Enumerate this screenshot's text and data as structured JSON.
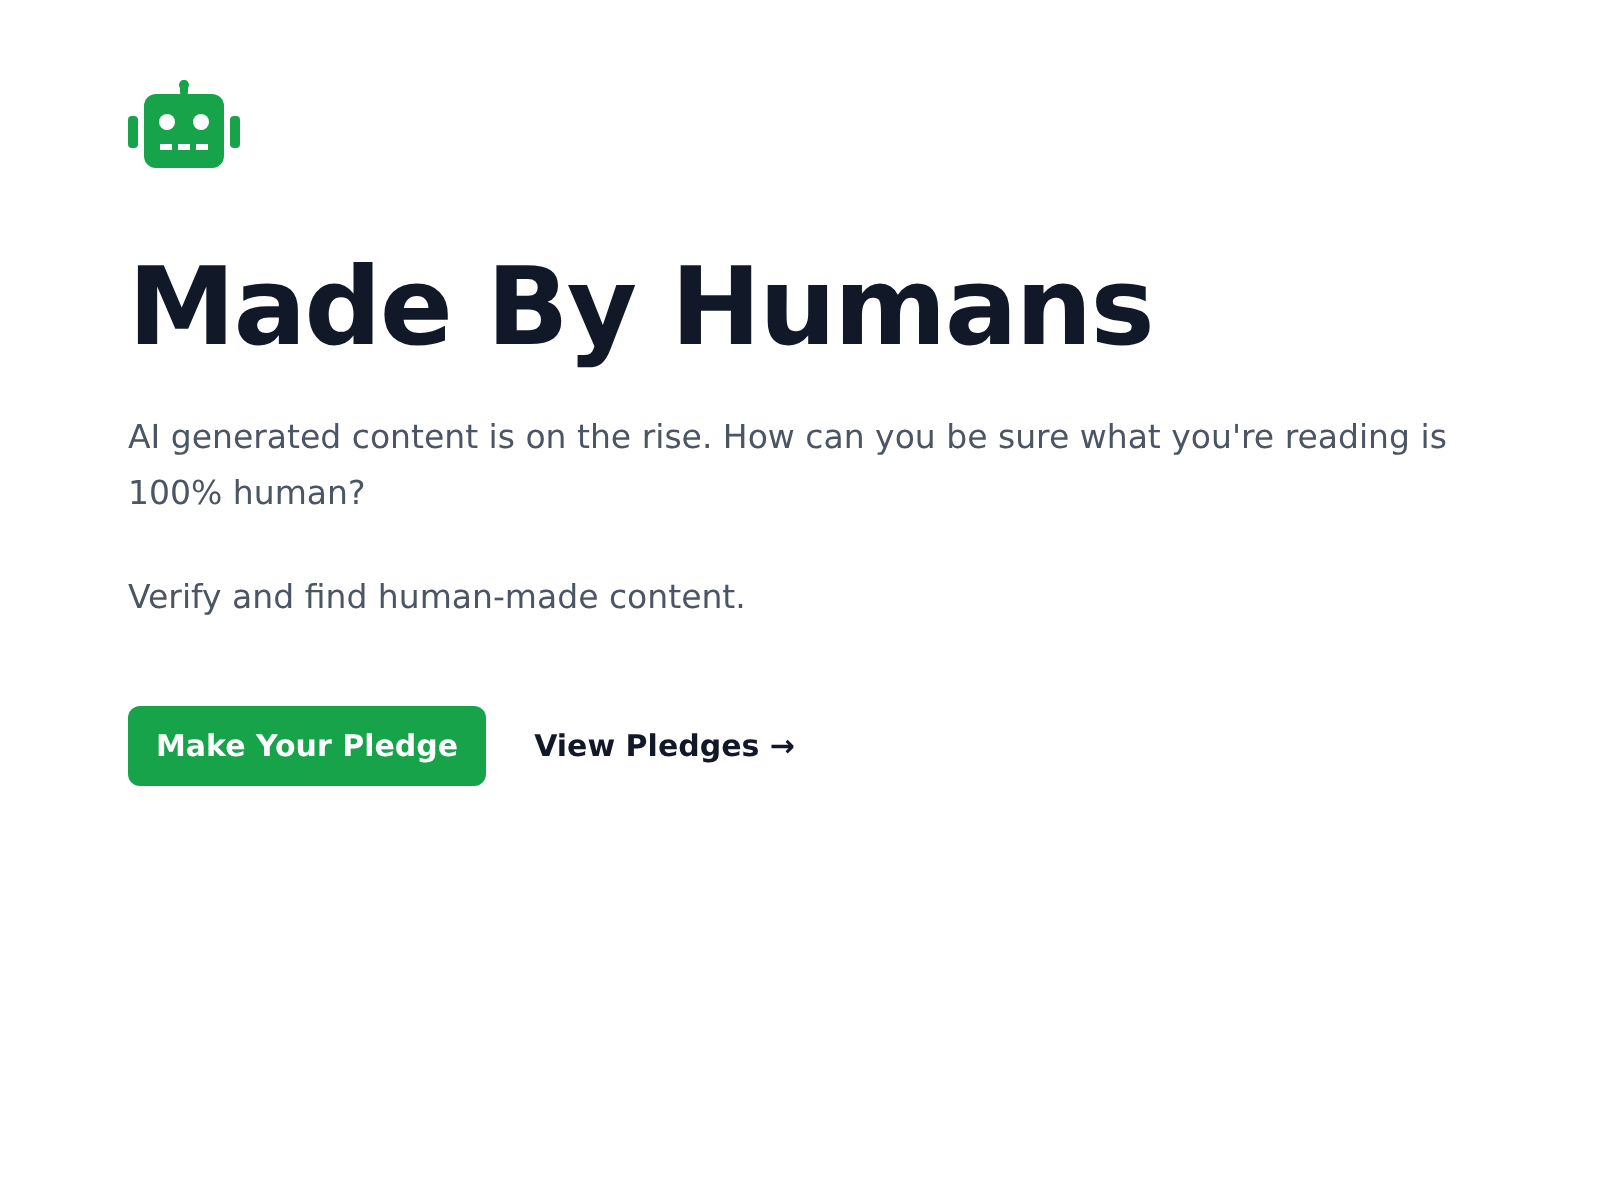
{
  "hero": {
    "title": "Made By Humans",
    "paragraphs": [
      "AI generated content is on the rise. How can you be sure what you're reading is 100% human?",
      "Verify and find human-made content."
    ]
  },
  "actions": [
    {
      "kind": "primary",
      "label": "Make Your Pledge"
    },
    {
      "kind": "link",
      "label": "View Pledges →"
    }
  ]
}
